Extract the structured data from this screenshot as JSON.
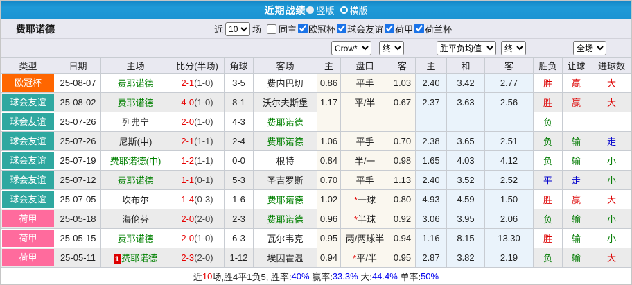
{
  "colors": {
    "title_bar_blue": "#1b93d2",
    "type_champions_orange": "#ff6600",
    "type_friendly_teal": "#2fa8a0",
    "type_eredivisie_pink": "#ff6b9d",
    "win_red": "#dd0000",
    "lose_green": "#007a00",
    "draw_blue": "#0000cc",
    "team_link_green": "#008000",
    "stat_blue": "#0000ee"
  },
  "title_bar": {
    "title": "近期战绩",
    "vertical_label": "竖版",
    "horizontal_label": "横版"
  },
  "team_bar": {
    "team_name": "费耶诺德",
    "recent_label": "近",
    "recent_count": "10",
    "unit_label": "场",
    "same_home_label": "同主",
    "competitions": [
      {
        "label": "欧冠杯",
        "checked": true
      },
      {
        "label": "球会友谊",
        "checked": true
      },
      {
        "label": "荷甲",
        "checked": true
      },
      {
        "label": "荷兰杯",
        "checked": true
      }
    ]
  },
  "filter_bar": {
    "bookmaker": "Crow*",
    "handicap_time": "终",
    "odds_type": "胜平负均值",
    "odds_time": "终",
    "scope": "全场"
  },
  "table": {
    "headers": [
      "类型",
      "日期",
      "主场",
      "比分(半场)",
      "角球",
      "客场",
      "主",
      "盘口",
      "客",
      "主",
      "和",
      "客",
      "胜负",
      "让球",
      "进球数"
    ],
    "rows": [
      {
        "type": "欧冠杯",
        "type_color": "#ff6600",
        "date": "25-08-07",
        "home": "费耶诺德",
        "home_is_team": true,
        "home_mark": "",
        "score": "2-1",
        "half": "(1-0)",
        "corners": "3-5",
        "away": "费内巴切",
        "away_is_team": false,
        "asian_home": "0.86",
        "handicap": "平手",
        "asian_away": "1.03",
        "euro_win": "2.40",
        "euro_draw": "3.42",
        "euro_lose": "2.77",
        "result": "胜",
        "result_color": "red",
        "handicap_result": "赢",
        "handicap_result_color": "red",
        "goals": "大",
        "goals_color": "red"
      },
      {
        "type": "球会友谊",
        "type_color": "#2fa8a0",
        "date": "25-08-02",
        "home": "费耶诺德",
        "home_is_team": true,
        "home_mark": "",
        "score": "4-0",
        "half": "(1-0)",
        "corners": "8-1",
        "away": "沃尔夫斯堡",
        "away_is_team": false,
        "asian_home": "1.17",
        "handicap": "平/半",
        "asian_away": "0.67",
        "euro_win": "2.37",
        "euro_draw": "3.63",
        "euro_lose": "2.56",
        "result": "胜",
        "result_color": "red",
        "handicap_result": "赢",
        "handicap_result_color": "red",
        "goals": "大",
        "goals_color": "red"
      },
      {
        "type": "球会友谊",
        "type_color": "#2fa8a0",
        "date": "25-07-26",
        "home": "列弗宁",
        "home_is_team": false,
        "home_mark": "",
        "score": "2-0",
        "half": "(1-0)",
        "corners": "4-3",
        "away": "费耶诺德",
        "away_is_team": true,
        "asian_home": "",
        "handicap": "",
        "asian_away": "",
        "euro_win": "",
        "euro_draw": "",
        "euro_lose": "",
        "result": "负",
        "result_color": "green",
        "handicap_result": "",
        "handicap_result_color": "green",
        "goals": "",
        "goals_color": "green"
      },
      {
        "type": "球会友谊",
        "type_color": "#2fa8a0",
        "date": "25-07-26",
        "home": "尼斯(中)",
        "home_is_team": false,
        "home_mark": "",
        "score": "2-1",
        "half": "(1-1)",
        "corners": "2-4",
        "away": "费耶诺德",
        "away_is_team": true,
        "asian_home": "1.06",
        "handicap": "平手",
        "asian_away": "0.70",
        "euro_win": "2.38",
        "euro_draw": "3.65",
        "euro_lose": "2.51",
        "result": "负",
        "result_color": "green",
        "handicap_result": "输",
        "handicap_result_color": "green",
        "goals": "走",
        "goals_color": "blue"
      },
      {
        "type": "球会友谊",
        "type_color": "#2fa8a0",
        "date": "25-07-19",
        "home": "费耶诺德(中)",
        "home_is_team": true,
        "home_mark": "",
        "score": "1-2",
        "half": "(1-1)",
        "corners": "0-0",
        "away": "根特",
        "away_is_team": false,
        "asian_home": "0.84",
        "handicap": "半/一",
        "asian_away": "0.98",
        "euro_win": "1.65",
        "euro_draw": "4.03",
        "euro_lose": "4.12",
        "result": "负",
        "result_color": "green",
        "handicap_result": "输",
        "handicap_result_color": "green",
        "goals": "小",
        "goals_color": "green"
      },
      {
        "type": "球会友谊",
        "type_color": "#2fa8a0",
        "date": "25-07-12",
        "home": "费耶诺德",
        "home_is_team": true,
        "home_mark": "",
        "score": "1-1",
        "half": "(0-1)",
        "corners": "5-3",
        "away": "圣吉罗斯",
        "away_is_team": false,
        "asian_home": "0.70",
        "handicap": "平手",
        "asian_away": "1.13",
        "euro_win": "2.40",
        "euro_draw": "3.52",
        "euro_lose": "2.52",
        "result": "平",
        "result_color": "blue",
        "handicap_result": "走",
        "handicap_result_color": "blue",
        "goals": "小",
        "goals_color": "green"
      },
      {
        "type": "球会友谊",
        "type_color": "#2fa8a0",
        "date": "25-07-05",
        "home": "坎布尔",
        "home_is_team": false,
        "home_mark": "",
        "score": "1-4",
        "half": "(0-3)",
        "corners": "1-6",
        "away": "费耶诺德",
        "away_is_team": true,
        "asian_home": "1.02",
        "handicap": "*一球",
        "asian_away": "0.80",
        "euro_win": "4.93",
        "euro_draw": "4.59",
        "euro_lose": "1.50",
        "result": "胜",
        "result_color": "red",
        "handicap_result": "赢",
        "handicap_result_color": "red",
        "goals": "大",
        "goals_color": "red"
      },
      {
        "type": "荷甲",
        "type_color": "#ff6b9d",
        "date": "25-05-18",
        "home": "海伦芬",
        "home_is_team": false,
        "home_mark": "",
        "score": "2-0",
        "half": "(2-0)",
        "corners": "2-3",
        "away": "费耶诺德",
        "away_is_team": true,
        "asian_home": "0.96",
        "handicap": "*半球",
        "asian_away": "0.92",
        "euro_win": "3.06",
        "euro_draw": "3.95",
        "euro_lose": "2.06",
        "result": "负",
        "result_color": "green",
        "handicap_result": "输",
        "handicap_result_color": "green",
        "goals": "小",
        "goals_color": "green"
      },
      {
        "type": "荷甲",
        "type_color": "#ff6b9d",
        "date": "25-05-15",
        "home": "费耶诺德",
        "home_is_team": true,
        "home_mark": "",
        "score": "2-0",
        "half": "(1-0)",
        "corners": "6-3",
        "away": "瓦尔韦克",
        "away_is_team": false,
        "asian_home": "0.95",
        "handicap": "两/两球半",
        "asian_away": "0.94",
        "euro_win": "1.16",
        "euro_draw": "8.15",
        "euro_lose": "13.30",
        "result": "胜",
        "result_color": "red",
        "handicap_result": "输",
        "handicap_result_color": "green",
        "goals": "小",
        "goals_color": "green"
      },
      {
        "type": "荷甲",
        "type_color": "#ff6b9d",
        "date": "25-05-11",
        "home": "费耶诺德",
        "home_is_team": true,
        "home_mark": "1",
        "score": "2-3",
        "half": "(2-0)",
        "corners": "1-12",
        "away": "埃因霍温",
        "away_is_team": false,
        "asian_home": "0.94",
        "handicap": "*平/半",
        "asian_away": "0.95",
        "euro_win": "2.87",
        "euro_draw": "3.82",
        "euro_lose": "2.19",
        "result": "负",
        "result_color": "green",
        "handicap_result": "输",
        "handicap_result_color": "green",
        "goals": "大",
        "goals_color": "red"
      }
    ]
  },
  "footer": {
    "segments": [
      {
        "text": "近",
        "color": "black"
      },
      {
        "text": "10",
        "color": "red"
      },
      {
        "text": "场,胜4平1负5, 胜率:",
        "color": "black"
      },
      {
        "text": "40%",
        "color": "blue"
      },
      {
        "text": " 赢率:",
        "color": "black"
      },
      {
        "text": "33.3%",
        "color": "blue"
      },
      {
        "text": " 大:",
        "color": "black"
      },
      {
        "text": "44.4%",
        "color": "blue"
      },
      {
        "text": " 单率:",
        "color": "black"
      },
      {
        "text": "50%",
        "color": "blue"
      }
    ]
  }
}
